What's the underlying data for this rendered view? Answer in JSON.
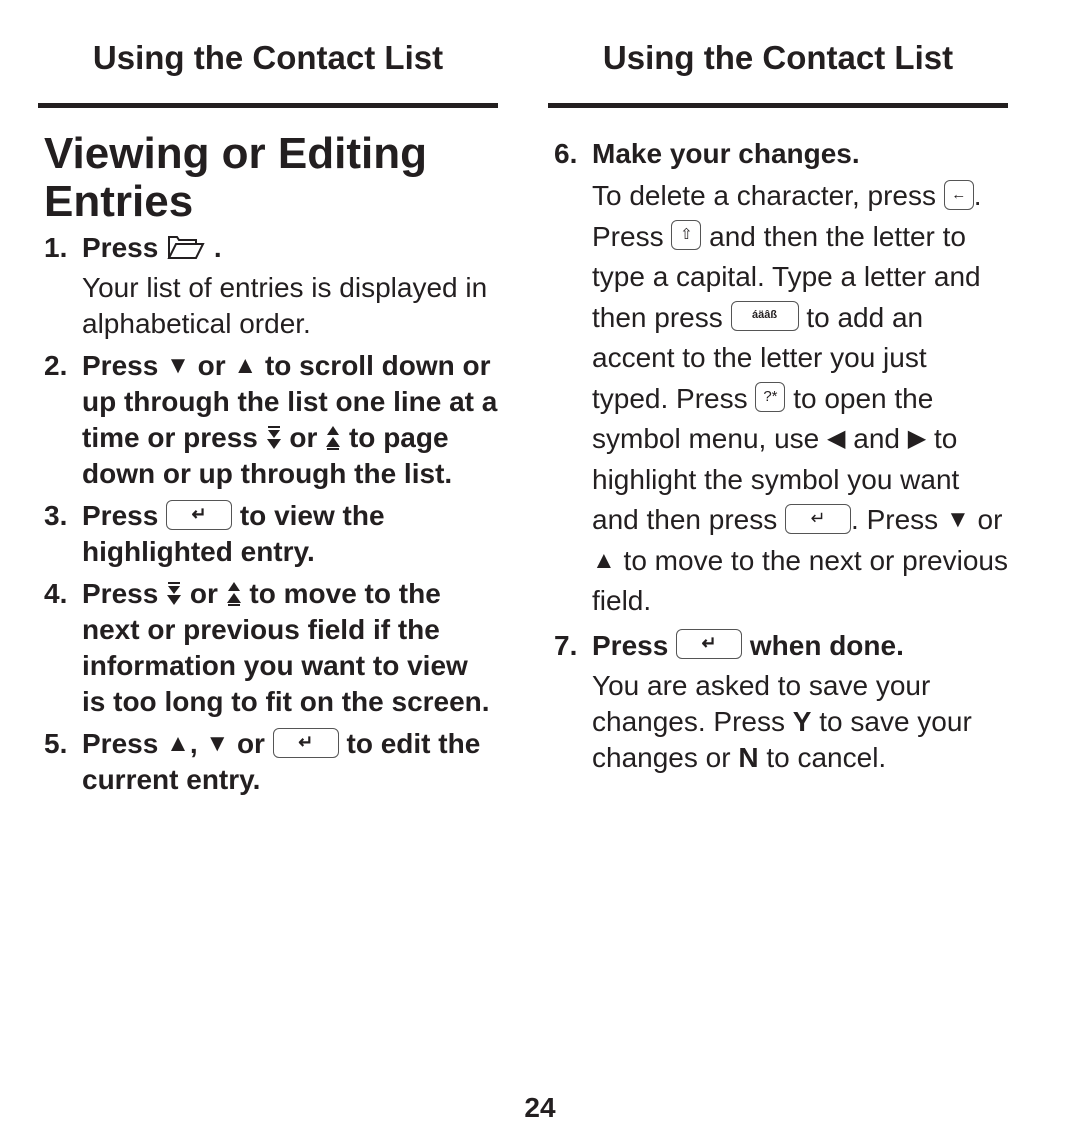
{
  "running_header": {
    "left": "Using the Contact List",
    "right": "Using the Contact List"
  },
  "section_title": "Viewing or Editing Entries",
  "icons": {
    "folder": "folder-icon",
    "down": "down-arrow-icon",
    "up": "up-arrow-icon",
    "page_down": "page-down-icon",
    "page_up": "page-up-icon",
    "enter": "enter-key-icon",
    "back": "backspace-key-icon",
    "shift": "shift-key-icon",
    "accent": "accent-key-icon",
    "symbol": "symbol-key-icon",
    "left": "left-arrow-icon",
    "right": "right-arrow-icon"
  },
  "glyphs": {
    "down": "▼",
    "up": "▲",
    "left": "◀",
    "right": "▶",
    "enter": "↵",
    "back": "←",
    "shift": "⇧",
    "accent": "áäâß",
    "symbol": "?*"
  },
  "steps": {
    "s1": {
      "num": "1.",
      "press": "Press",
      "end": ".",
      "body": "Your list of entries is displayed in alphabetical order."
    },
    "s2": {
      "num": "2.",
      "press": "Press",
      "or1": "or",
      "mid": "to scroll down or up through the list one line at a time or press",
      "or2": "or",
      "end": "to page down or up through the list."
    },
    "s3": {
      "num": "3.",
      "press": "Press",
      "end": "to view the highlighted entry."
    },
    "s4": {
      "num": "4.",
      "press": "Press",
      "or": "or",
      "end": "to move to the next or previous field if the information you want to view is too long to fit on the screen."
    },
    "s5": {
      "num": "5.",
      "press": "Press",
      "comma": ",",
      "or": "or",
      "end": "to edit the current entry."
    },
    "s6": {
      "num": "6.",
      "lead": "Make your changes.",
      "t1": "To delete a character, press",
      "t2": ". Press",
      "t3": "and then the letter to type a capital. Type a letter and then press",
      "t4": "to add an accent to the letter you just typed. Press",
      "t5": "to open the symbol menu, use",
      "t6": "and",
      "t7": "to highlight the symbol you want and then press",
      "t8": ". Press",
      "t9": "or",
      "t10": "to move to the next or previous field."
    },
    "s7": {
      "num": "7.",
      "press": "Press",
      "end": "when done.",
      "b1": "You are asked to save your changes. Press",
      "y": "Y",
      "b2": "to save your changes or",
      "n": "N",
      "b3": "to cancel."
    }
  },
  "page_number": "24"
}
